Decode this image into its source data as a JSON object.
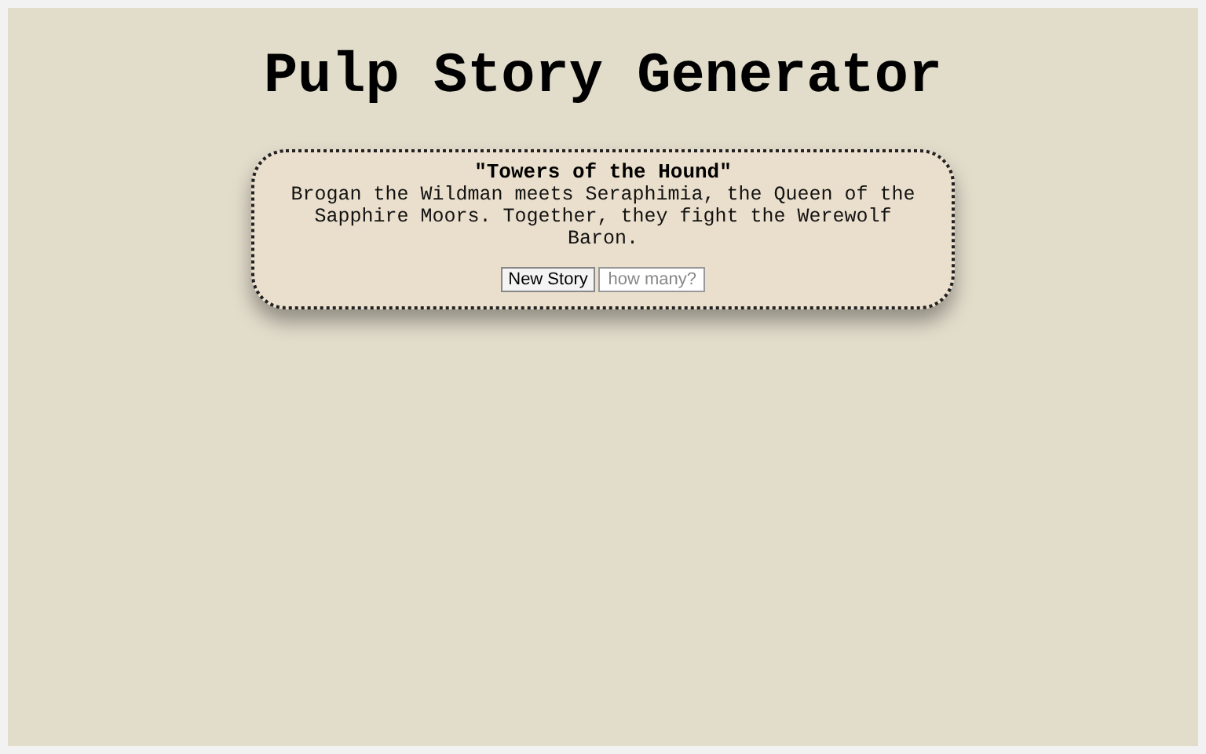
{
  "title": "Pulp Story Generator",
  "story": {
    "title": "\"Towers of the Hound\"",
    "text": "Brogan the Wildman meets Seraphimia, the Queen of the Sapphire Moors. Together, they fight the Werewolf Baron."
  },
  "controls": {
    "button": "New Story",
    "count_placeholder": "how many?"
  }
}
